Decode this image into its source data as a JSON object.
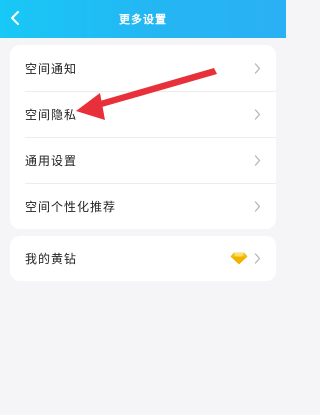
{
  "header": {
    "title": "更多设置",
    "background": "#1fbdf5"
  },
  "settings": {
    "items": [
      {
        "label": "空间通知"
      },
      {
        "label": "空间隐私"
      },
      {
        "label": "通用设置"
      },
      {
        "label": "空间个性化推荐"
      }
    ]
  },
  "vip": {
    "label": "我的黄钻",
    "icon": "yellow-diamond-icon",
    "icon_color": "#f5c518"
  },
  "annotation": {
    "arrow_color": "#e8303a",
    "points_to": "空间隐私"
  }
}
